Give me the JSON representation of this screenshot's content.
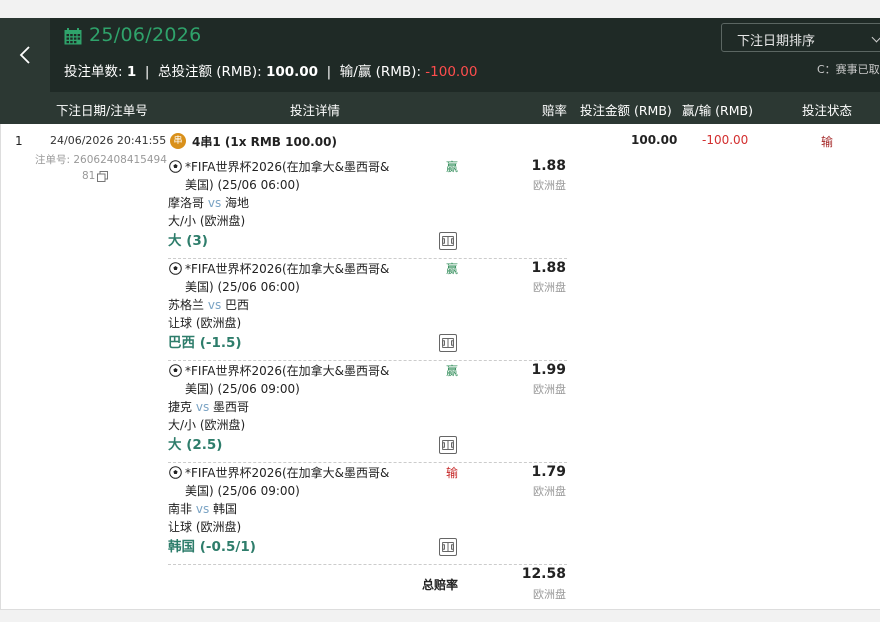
{
  "header": {
    "date": "25/06/2026",
    "summary": {
      "count_label": "投注单数:",
      "count_value": "1",
      "total_label": "总投注额 (RMB):",
      "total_value": "100.00",
      "wl_label": "输/赢 (RMB):",
      "wl_value": "-100.00"
    },
    "sort_label": "下注日期排序",
    "note": "C：赛事已取"
  },
  "columns": {
    "date_id": "下注日期/注单号",
    "details": "投注详情",
    "odds": "赔率",
    "stake": "投注金额 (RMB)",
    "winloss": "赢/输 (RMB)",
    "status": "投注状态"
  },
  "bet": {
    "index": "1",
    "datetime": "24/06/2026 20:41:55",
    "id_label": "注单号: 26062408415494",
    "id_tail": "81",
    "parlay_badge": "串",
    "parlay_title": "4串1 (1x RMB 100.00)",
    "stake": "100.00",
    "winloss": "-100.00",
    "status": "输",
    "legs": [
      {
        "event_line1": "*FIFA世界杯2026(在加拿大&墨西哥&",
        "event_line2": "美国) (25/06 06:00)",
        "home": "摩洛哥",
        "vs": "vs",
        "away": "海地",
        "market": "大/小 (欧洲盘)",
        "selection": "大 (3)",
        "result": "赢",
        "odds": "1.88",
        "odds_type": "欧洲盘"
      },
      {
        "event_line1": "*FIFA世界杯2026(在加拿大&墨西哥&",
        "event_line2": "美国) (25/06 06:00)",
        "home": "苏格兰",
        "vs": "vs",
        "away": "巴西",
        "market": "让球 (欧洲盘)",
        "selection": "巴西 (-1.5)",
        "result": "赢",
        "odds": "1.88",
        "odds_type": "欧洲盘"
      },
      {
        "event_line1": "*FIFA世界杯2026(在加拿大&墨西哥&",
        "event_line2": "美国) (25/06 09:00)",
        "home": "捷克",
        "vs": "vs",
        "away": "墨西哥",
        "market": "大/小 (欧洲盘)",
        "selection": "大 (2.5)",
        "result": "赢",
        "odds": "1.99",
        "odds_type": "欧洲盘"
      },
      {
        "event_line1": "*FIFA世界杯2026(在加拿大&墨西哥&",
        "event_line2": "美国) (25/06 09:00)",
        "home": "南非",
        "vs": "vs",
        "away": "韩国",
        "market": "让球 (欧洲盘)",
        "selection": "韩国 (-0.5/1)",
        "result": "输",
        "odds": "1.79",
        "odds_type": "欧洲盘"
      }
    ],
    "total_label": "总赔率",
    "total_odds": "12.58",
    "total_odds_type": "欧洲盘"
  },
  "colors": {
    "header_bg": "#1f2a26",
    "accent_green": "#2fa36b",
    "negative": "#ff4d4d",
    "selection": "#2e7d6b"
  }
}
